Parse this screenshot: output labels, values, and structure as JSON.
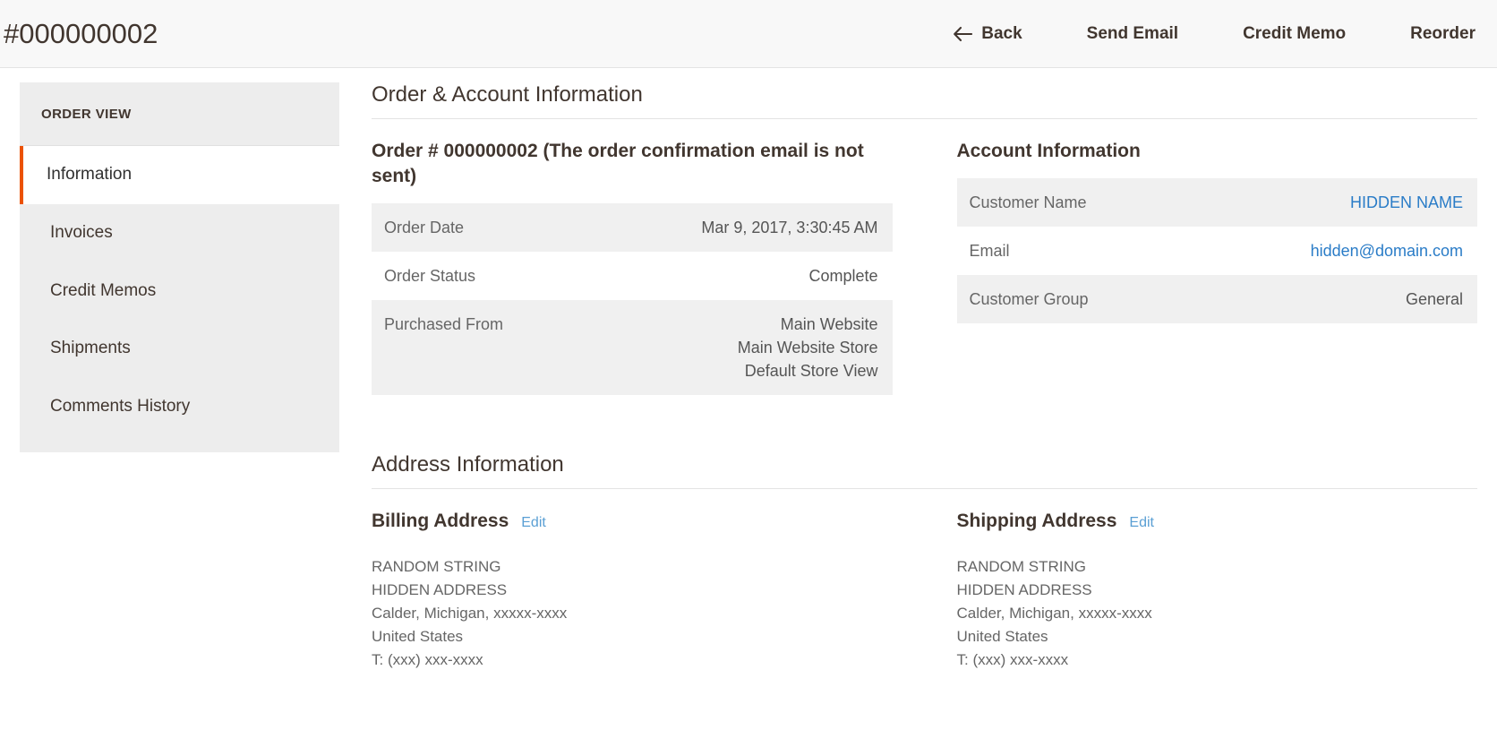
{
  "header": {
    "title": "#000000002",
    "actions": [
      {
        "label": "Back",
        "icon": "arrow-left-icon"
      },
      {
        "label": "Send Email",
        "icon": null
      },
      {
        "label": "Credit Memo",
        "icon": null
      },
      {
        "label": "Reorder",
        "icon": null
      }
    ]
  },
  "sidebar": {
    "title": "ORDER VIEW",
    "items": [
      {
        "label": "Information",
        "active": true
      },
      {
        "label": "Invoices",
        "active": false
      },
      {
        "label": "Credit Memos",
        "active": false
      },
      {
        "label": "Shipments",
        "active": false
      },
      {
        "label": "Comments History",
        "active": false
      }
    ]
  },
  "order_account_section": {
    "title": "Order & Account Information",
    "order": {
      "heading": "Order # 000000002 (The order confirmation email is not sent)",
      "rows": [
        {
          "label": "Order Date",
          "value": "Mar 9, 2017, 3:30:45 AM",
          "type": "text"
        },
        {
          "label": "Order Status",
          "value": "Complete",
          "type": "text"
        },
        {
          "label": "Purchased From",
          "value": [
            "Main Website",
            "Main Website Store",
            "Default Store View"
          ],
          "type": "multiline"
        }
      ]
    },
    "account": {
      "heading": "Account Information",
      "rows": [
        {
          "label": "Customer Name",
          "value": "HIDDEN NAME",
          "type": "link"
        },
        {
          "label": "Email",
          "value": "hidden@domain.com",
          "type": "link"
        },
        {
          "label": "Customer Group",
          "value": "General",
          "type": "text"
        }
      ]
    }
  },
  "address_section": {
    "title": "Address Information",
    "billing": {
      "heading": "Billing Address",
      "edit_label": "Edit",
      "lines": [
        "RANDOM STRING",
        "HIDDEN ADDRESS",
        "Calder, Michigan, xxxxx-xxxx",
        "United States",
        "T: (xxx) xxx-xxxx"
      ]
    },
    "shipping": {
      "heading": "Shipping Address",
      "edit_label": "Edit",
      "lines": [
        "RANDOM STRING",
        "HIDDEN ADDRESS",
        "Calder, Michigan, xxxxx-xxxx",
        "United States",
        "T: (xxx) xxx-xxxx"
      ]
    }
  },
  "colors": {
    "accent_orange": "#eb5202",
    "link_blue": "#2a7cc7",
    "edit_link_blue": "#5a9fd4",
    "header_bg": "#f8f8f8",
    "sidebar_bg": "#ededed",
    "row_stripe": "#f0f0f0",
    "text_dark": "#41362f"
  }
}
